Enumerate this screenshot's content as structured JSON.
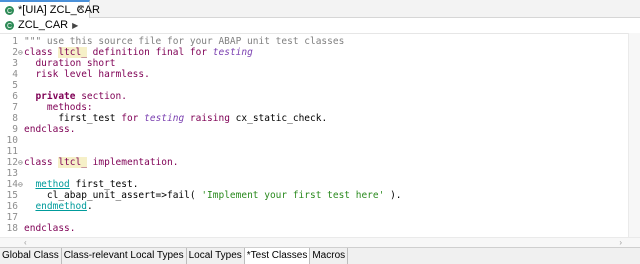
{
  "editor_tab": {
    "title": "*[UIA] ZCL_CAR",
    "close_glyph": "✕"
  },
  "breadcrumb": {
    "label": "ZCL_CAR",
    "chevron": "▶"
  },
  "colors": {
    "keyword": "#7f0055",
    "comment": "#808080",
    "string": "#2a8a1e",
    "teal_keyword": "#009b9b",
    "purple_italic": "#7a3fb0",
    "blue": "#0000c0",
    "highlight": "#f6f0c8"
  },
  "lines": [
    {
      "n": "1",
      "fold": "",
      "tokens": [
        {
          "t": "\"\"\" use this source file for your ABAP unit test classes",
          "c": "comment"
        }
      ]
    },
    {
      "n": "2",
      "fold": "⊖",
      "tokens": [
        {
          "t": "class ",
          "c": "keyword"
        },
        {
          "t": "ltcl_",
          "c": "hl"
        },
        {
          "t": " definition final for ",
          "c": "keyword"
        },
        {
          "t": "testing",
          "c": "italic"
        }
      ]
    },
    {
      "n": "3",
      "fold": "",
      "tokens": [
        {
          "t": "  duration short",
          "c": "keyword"
        }
      ]
    },
    {
      "n": "4",
      "fold": "",
      "tokens": [
        {
          "t": "  risk level harmless.",
          "c": "keyword"
        }
      ]
    },
    {
      "n": "5",
      "fold": "",
      "tokens": [
        {
          "t": "",
          "c": "plain"
        }
      ]
    },
    {
      "n": "6",
      "fold": "",
      "tokens": [
        {
          "t": "  private",
          "c": "kwbold"
        },
        {
          "t": " section.",
          "c": "keyword"
        }
      ]
    },
    {
      "n": "7",
      "fold": "",
      "tokens": [
        {
          "t": "    methods:",
          "c": "keyword"
        }
      ]
    },
    {
      "n": "8",
      "fold": "",
      "tokens": [
        {
          "t": "      first_test ",
          "c": "plain"
        },
        {
          "t": "for ",
          "c": "keyword"
        },
        {
          "t": "testing",
          "c": "italic"
        },
        {
          "t": " raising ",
          "c": "keyword"
        },
        {
          "t": "cx_static_check.",
          "c": "plain"
        }
      ]
    },
    {
      "n": "9",
      "fold": "",
      "tokens": [
        {
          "t": "endclass.",
          "c": "keyword"
        }
      ]
    },
    {
      "n": "10",
      "fold": "",
      "tokens": [
        {
          "t": "",
          "c": "plain"
        }
      ]
    },
    {
      "n": "11",
      "fold": "",
      "tokens": [
        {
          "t": "",
          "c": "plain"
        }
      ]
    },
    {
      "n": "12",
      "fold": "⊖",
      "tokens": [
        {
          "t": "class ",
          "c": "keyword"
        },
        {
          "t": "ltcl_",
          "c": "hl"
        },
        {
          "t": " implementation.",
          "c": "keyword"
        }
      ]
    },
    {
      "n": "13",
      "fold": "",
      "tokens": [
        {
          "t": "",
          "c": "plain"
        }
      ]
    },
    {
      "n": "14",
      "fold": "⊖",
      "tokens": [
        {
          "t": "  ",
          "c": "plain"
        },
        {
          "t": "method",
          "c": "teal"
        },
        {
          "t": " first_test.",
          "c": "plain"
        }
      ]
    },
    {
      "n": "15",
      "fold": "",
      "tokens": [
        {
          "t": "    cl_abap_unit_assert=>fail( ",
          "c": "plain"
        },
        {
          "t": "'Implement your first test here'",
          "c": "string"
        },
        {
          "t": " ).",
          "c": "plain"
        }
      ]
    },
    {
      "n": "16",
      "fold": "",
      "tokens": [
        {
          "t": "  ",
          "c": "plain"
        },
        {
          "t": "endmethod",
          "c": "teal"
        },
        {
          "t": ".",
          "c": "plain"
        }
      ]
    },
    {
      "n": "17",
      "fold": "",
      "tokens": [
        {
          "t": "",
          "c": "plain"
        }
      ]
    },
    {
      "n": "18",
      "fold": "",
      "tokens": [
        {
          "t": "endclass.",
          "c": "keyword"
        }
      ]
    }
  ],
  "bottom_tabs": [
    {
      "label": "Global Class",
      "active": false
    },
    {
      "label": "Class-relevant Local Types",
      "active": false
    },
    {
      "label": "Local Types",
      "active": false
    },
    {
      "label": "*Test Classes",
      "active": true
    },
    {
      "label": "Macros",
      "active": false
    }
  ],
  "scroll": {
    "left_arrow": "‹",
    "right_arrow": "›"
  }
}
